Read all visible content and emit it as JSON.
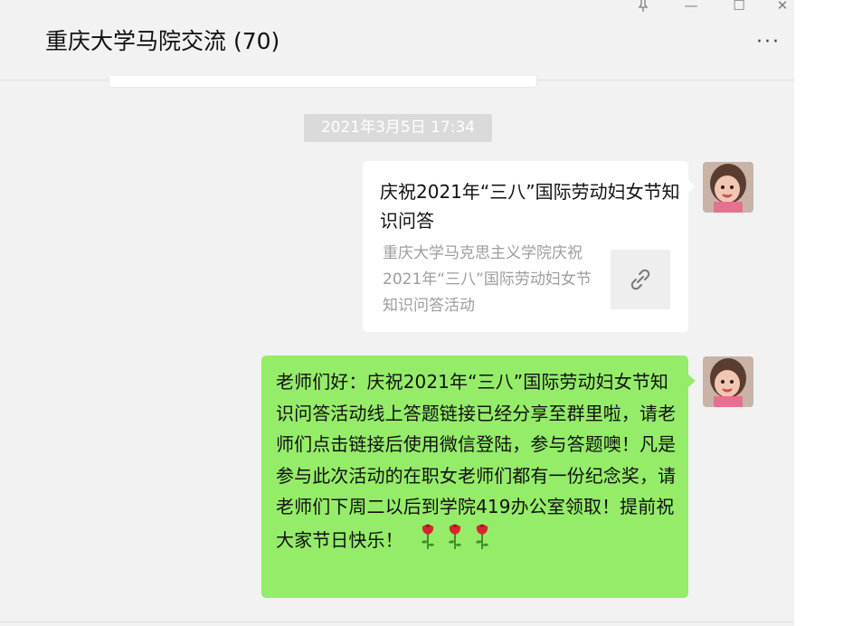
{
  "window": {
    "controls": {
      "pin_icon": "pin-icon",
      "minimize_label": "—",
      "maximize_label": "☐",
      "close_label": "✕"
    }
  },
  "header": {
    "title": "重庆大学马院交流 (70)",
    "more_label": "···"
  },
  "chat": {
    "timestamp": "2021年3月5日 17:34",
    "messages": [
      {
        "type": "link-card",
        "sender_avatar": "avatar-girl",
        "title": "庆祝2021年“三八”国际劳动妇女节知识问答",
        "description": "重庆大学马克思主义学院庆祝2021年“三八”国际劳动妇女节知识问答活动",
        "thumb_icon": "link-icon"
      },
      {
        "type": "text",
        "sender_avatar": "avatar-girl",
        "text": "老师们好：庆祝2021年“三八”国际劳动妇女节知识问答活动线上答题链接已经分享至群里啦，请老师们点击链接后使用微信登陆，参与答题噢！凡是参与此次活动的在职女老师们都有一份纪念奖，请老师们下周二以后到学院419办公室领取！提前祝大家节日快乐！",
        "emoji": [
          "rose-icon",
          "rose-icon",
          "rose-icon"
        ]
      }
    ]
  },
  "colors": {
    "bubble_green": "#95ec69",
    "background": "#f2f2f2",
    "timestamp_bg": "#dadada"
  }
}
